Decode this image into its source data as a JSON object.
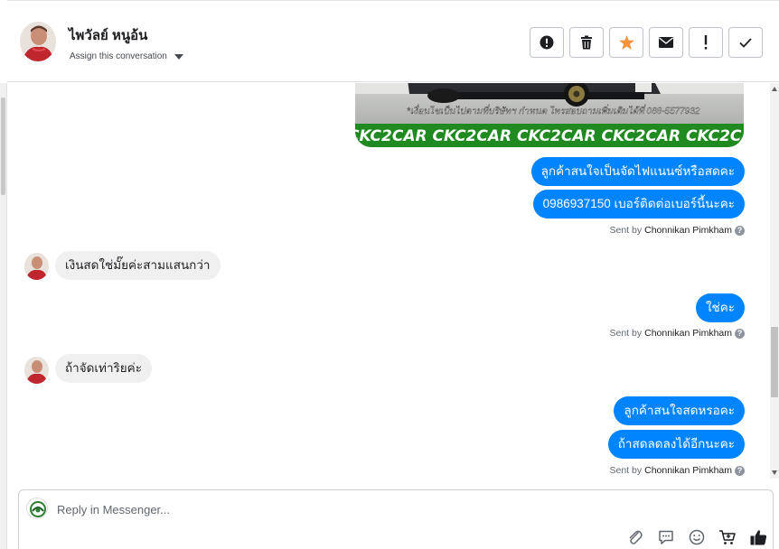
{
  "header": {
    "contact_name": "ไพวัลย์ หนูอ้น",
    "assign_label": "Assign this conversation",
    "actions": [
      {
        "name": "mark-spam",
        "icon": "exclamation-circle-icon"
      },
      {
        "name": "delete",
        "icon": "trash-icon"
      },
      {
        "name": "star",
        "icon": "star-icon",
        "color": "#f7923a"
      },
      {
        "name": "mark-unread",
        "icon": "envelope-icon"
      },
      {
        "name": "follow-up",
        "icon": "exclamation-icon"
      },
      {
        "name": "done",
        "icon": "checkmark-icon"
      }
    ]
  },
  "thread": {
    "image_attachment": {
      "caption": "*เงื่อนไขเป็นไปตามที่บริษัทฯ กำหนด ไทรสอบถามเพิ่มเติมได้ที่ 088-5577932",
      "banner": "CKC2CAR CKC2CAR CKC2CAR CKC2CAR CKC2CAR CKC2"
    },
    "messages": [
      {
        "side": "out",
        "text": "ลูกค้าสนใจเป็นจัดไฟแนนซ์หรือสดคะ"
      },
      {
        "side": "out",
        "text": "0986937150 เบอร์ติดต่อเบอร์นี้นะคะ"
      },
      {
        "side": "in",
        "text": "เงินสดใช่มั๊ยค่ะสามแสนกว่า"
      },
      {
        "side": "out",
        "text": "ใช่คะ"
      },
      {
        "side": "in",
        "text": "ถ้าจัดเท่าริยค่ะ"
      },
      {
        "side": "out",
        "text": "ลูกค้าสนใจสดหรอคะ"
      },
      {
        "side": "out",
        "text": "ถ้าสดลดลงได้อีกนะคะ"
      }
    ],
    "sent_by_prefix": "Sent by",
    "sent_by_name": "Chonnikan Pimkham",
    "help_glyph": "?"
  },
  "composer": {
    "placeholder": "Reply in Messenger...",
    "value": "",
    "tools": [
      "paperclip-icon",
      "saved-reply-icon",
      "emoji-icon",
      "cart-icon",
      "thumbs-up-icon"
    ]
  },
  "colors": {
    "outgoing_bubble": "#0084ff",
    "incoming_bubble": "#f0f0f0",
    "star": "#f7923a",
    "banner_green": "#1f8a1f"
  }
}
